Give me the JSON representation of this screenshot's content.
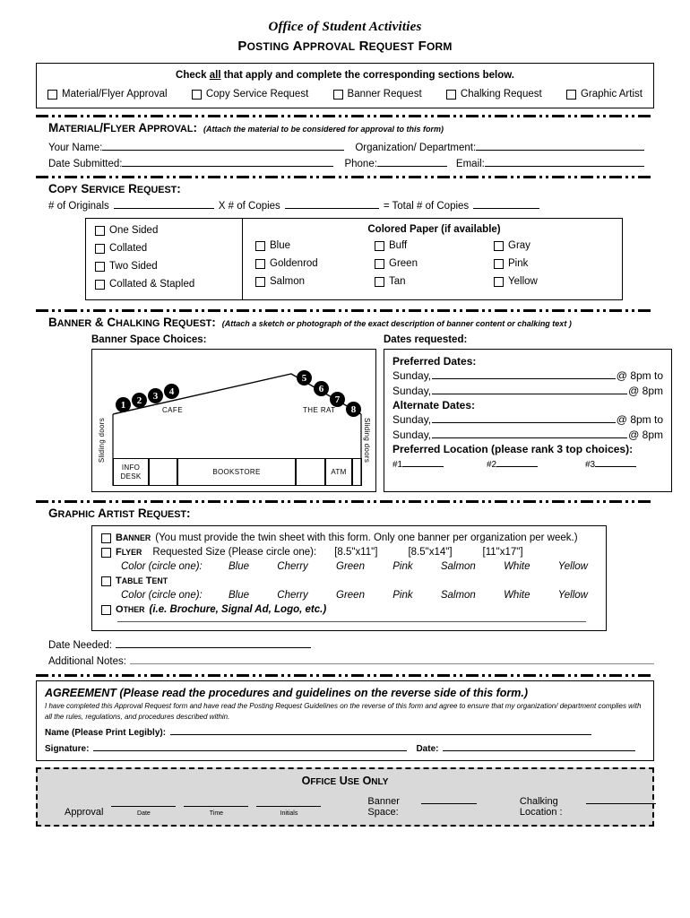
{
  "header": {
    "office": "Office of Student Activities",
    "form_title": "POSTING APPROVAL REQUEST FORM"
  },
  "checkbox_box": {
    "instruction_pre": "Check ",
    "instruction_underlined": "all",
    "instruction_post": " that apply and complete the corresponding sections below.",
    "options": [
      "Material/Flyer Approval",
      "Copy Service Request",
      "Banner Request",
      "Chalking Request",
      "Graphic Artist"
    ]
  },
  "material_section": {
    "title": "MATERIAL/FLYER APPROVAL:",
    "note": "(Attach the material to be considered for approval to this form)",
    "labels": {
      "your_name": "Your Name:",
      "organization": "Organization/ Department:",
      "date_submitted": "Date Submitted:",
      "phone": "Phone:",
      "email": "Email:"
    }
  },
  "copy_section": {
    "title": "COPY SERVICE REQUEST:",
    "originals_label": "# of Originals",
    "copies_label": "X # of Copies",
    "total_label": "= Total # of Copies",
    "sided_options": [
      "One Sided",
      "Collated",
      "Two Sided",
      "Collated & Stapled"
    ],
    "colored_paper_title": "Colored Paper (if available)",
    "paper_colors": [
      "Blue",
      "Buff",
      "Gray",
      "Goldenrod",
      "Green",
      "Pink",
      "Salmon",
      "Tan",
      "Yellow"
    ]
  },
  "banner_section": {
    "title": "BANNER & CHALKING REQUEST:",
    "note": "(Attach a sketch or photograph of the exact description of banner content or chalking text )",
    "diagram_heading": "Banner Space Choices:",
    "dates_heading": "Dates requested:",
    "diagram": {
      "numbers": [
        "1",
        "2",
        "3",
        "4",
        "5",
        "6",
        "7",
        "8"
      ],
      "cafe_label": "CAFE",
      "rat_label": "THE RAT",
      "left_doors": "Sliding doors",
      "right_doors": "Sliding doors",
      "bottom_cells": [
        "INFO DESK",
        "",
        "BOOKSTORE",
        "",
        "ATM",
        ""
      ]
    },
    "dates": {
      "preferred_title": "Preferred Dates:",
      "alternate_title": "Alternate Dates:",
      "sunday": "Sunday,",
      "at_8pm_to": "@ 8pm to",
      "at_8pm": "@ 8pm",
      "location_title": "Preferred Location (please rank 3 top choices):",
      "ranks": [
        "#1",
        "#2",
        "#3"
      ]
    }
  },
  "graphic_section": {
    "title": "GRAPHIC ARTIST REQUEST:",
    "banner_label": "BANNER",
    "banner_note": "(You must provide the twin sheet with this form.  Only one banner per organization per week.)",
    "flyer_label": "FLYER",
    "flyer_size_label": "Requested Size (Please circle one):",
    "flyer_sizes": [
      "[8.5\"x11\"]",
      "[8.5\"x14\"]",
      "[11\"x17\"]"
    ],
    "color_label": "Color (circle one):",
    "colors": [
      "Blue",
      "Cherry",
      "Green",
      "Pink",
      "Salmon",
      "White",
      "Yellow"
    ],
    "table_tent_label": "TABLE TENT",
    "other_label": "OTHER",
    "other_note": "(i.e. Brochure, Signal Ad, Logo, etc.)"
  },
  "bottom_fields": {
    "date_needed": "Date Needed:",
    "additional_notes": "Additional Notes:"
  },
  "agreement": {
    "title_bold": "AGREEMENT",
    "title_rest": " (Please read the procedures and guidelines on the reverse side of this form.)",
    "body": "I have completed this Approval Request form and have read the Posting Request Guidelines on the reverse of this form and agree to ensure that my organization/ department complies with all the rules, regulations, and procedures described within.",
    "name_label": "Name (Please Print Legibly):",
    "signature_label": "Signature:",
    "date_label": "Date:"
  },
  "office_use": {
    "title": "OFFICE USE ONLY",
    "approval_label": "Approval",
    "slots": [
      "Date",
      "Time",
      "Initials"
    ],
    "banner_space_label": "Banner Space:",
    "chalking_location_label": "Chalking Location :"
  }
}
